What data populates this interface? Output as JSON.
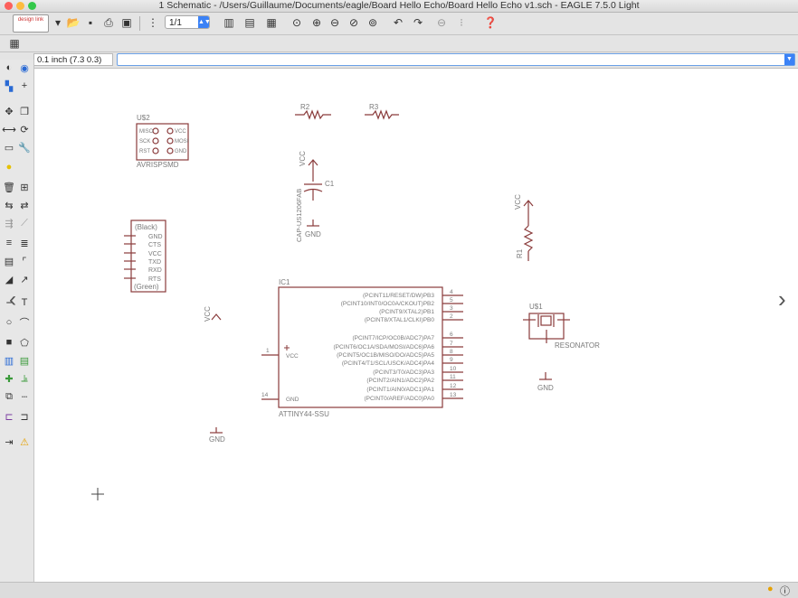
{
  "window": {
    "title": "1 Schematic - /Users/Guillaume/Documents/eagle/Board Hello Echo/Board Hello Echo v1.sch - EAGLE 7.5.0 Light"
  },
  "toolbar": {
    "logo_label": "design link",
    "sheet_value": "1/1"
  },
  "command_bar": {
    "grid_readout": "0.1 inch (7.3 0.3)",
    "command_value": ""
  },
  "schematic": {
    "usb": {
      "name": "U$2",
      "value": "AVRISPSMD",
      "pins_left": [
        "MISO",
        "SCK",
        "RST"
      ],
      "pins_right": [
        "VCC",
        "MOSI",
        "GND"
      ]
    },
    "ftdi": {
      "top": "(Black)",
      "bottom": "(Green)",
      "pins": [
        "GND",
        "CTS",
        "VCC",
        "TXD",
        "RXD",
        "RTS"
      ]
    },
    "r2": "R2",
    "r3": "R3",
    "vcc_label": "VCC",
    "gnd_label": "GND",
    "c1": {
      "name": "C1",
      "value": "CAP-US1206FAB"
    },
    "r1": "R1",
    "ic1": {
      "name": "IC1",
      "value": "ATTINY44-SSU",
      "left_pins": [
        {
          "num": "1",
          "label": "VCC"
        },
        {
          "num": "14",
          "label": "GND"
        }
      ],
      "right_pins": [
        {
          "label": "(PCINT11/RESET/DW)PB3",
          "num": "4"
        },
        {
          "label": "(PCINT10/INT0/OC0A/CKOUT)PB2",
          "num": "5"
        },
        {
          "label": "(PCINT9/XTAL2)PB1",
          "num": "3"
        },
        {
          "label": "(PCINT8/XTAL1/CLKI)PB0",
          "num": "2"
        },
        {
          "label": "(PCINT7/ICP/OC0B/ADC7)PA7",
          "num": "6"
        },
        {
          "label": "(PCINT6/OC1A/SDA/MOSI/ADC6)PA6",
          "num": "7"
        },
        {
          "label": "(PCINT5/OC1B/MISO/DO/ADC5)PA5",
          "num": "8"
        },
        {
          "label": "(PCINT4/T1/SCL/USCK/ADC4)PA4",
          "num": "9"
        },
        {
          "label": "(PCINT3/T0/ADC3)PA3",
          "num": "10"
        },
        {
          "label": "(PCINT2/AIN1/ADC2)PA2",
          "num": "11"
        },
        {
          "label": "(PCINT1/AIN0/ADC1)PA1",
          "num": "12"
        },
        {
          "label": "(PCINT0/AREF/ADC0)PA0",
          "num": "13"
        }
      ]
    },
    "resonator": {
      "name": "U$1",
      "value": "RESONATOR"
    }
  },
  "colors": {
    "schematic_red": "#8a3b3b",
    "canvas_bg": "#ffffff",
    "accent_blue": "#3b82f6"
  },
  "icons": [
    "info-icon",
    "eye-icon",
    "save-icon",
    "print-icon",
    "undo-icon",
    "redo-icon",
    "zoom-in-icon",
    "zoom-out-icon",
    "help-icon",
    "warning-icon",
    "nav-left-icon",
    "nav-right-icon"
  ]
}
